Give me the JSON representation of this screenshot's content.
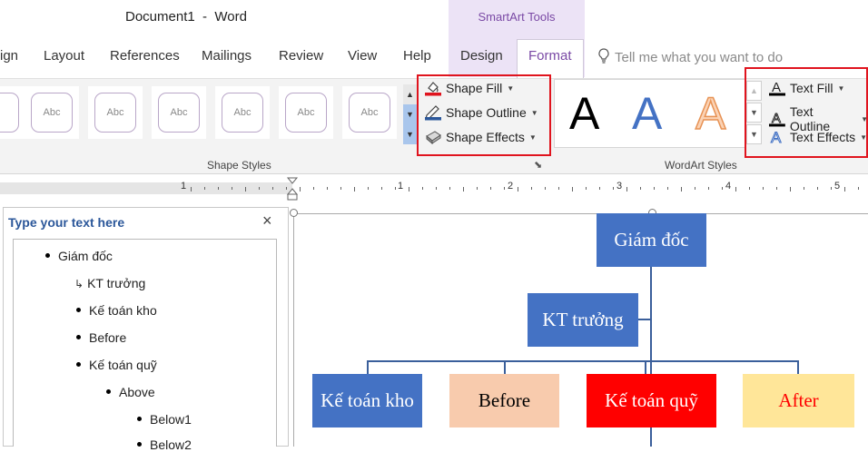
{
  "window": {
    "title": "Document1  -  Word",
    "context_tab_group": "SmartArt Tools"
  },
  "tabs": [
    "ign",
    "Layout",
    "References",
    "Mailings",
    "Review",
    "View",
    "Help",
    "Design",
    "Format"
  ],
  "tell_me": {
    "placeholder": "Tell me what you want to do",
    "icon": "lightbulb-icon"
  },
  "ribbon": {
    "shape_styles": {
      "thumb_label": "Abc",
      "group_label": "Shape Styles"
    },
    "shape_commands": {
      "fill": "Shape Fill",
      "outline": "Shape Outline",
      "effects": "Shape Effects"
    },
    "wordart": {
      "letter": "A",
      "group_label": "WordArt Styles"
    },
    "text_commands": {
      "fill": "Text Fill",
      "outline": "Text Outline",
      "effects": "Text Effects"
    },
    "colors": {
      "highlight_box": "#e0141e",
      "shape_fill_swatch": "#e0141e",
      "context_tab": "#7a49a5"
    }
  },
  "ruler": {
    "numbers": [
      "1",
      "1",
      "2",
      "3",
      "4",
      "5"
    ]
  },
  "text_pane": {
    "title": "Type your text here",
    "close": "×",
    "items": [
      "Giám đốc",
      "KT trưởng",
      "Kế toán kho",
      "Before",
      "Kế toán quỹ",
      "Above",
      "Below1",
      "Below2"
    ]
  },
  "diagram": {
    "nodes": [
      {
        "label": "Giám đốc",
        "fill": "#4472c4",
        "text_color": "#ffffff"
      },
      {
        "label": "KT trưởng",
        "fill": "#4472c4",
        "text_color": "#ffffff"
      },
      {
        "label": "Kế toán kho",
        "fill": "#4472c4",
        "text_color": "#ffffff"
      },
      {
        "label": "Before",
        "fill": "#f8cbad",
        "text_color": "#000000"
      },
      {
        "label": "Kế toán quỹ",
        "fill": "#ff0000",
        "text_color": "#ffffff"
      },
      {
        "label": "After",
        "fill": "#ffe699",
        "text_color": "#ff0000"
      }
    ],
    "connector_color": "#3a5f9b"
  }
}
